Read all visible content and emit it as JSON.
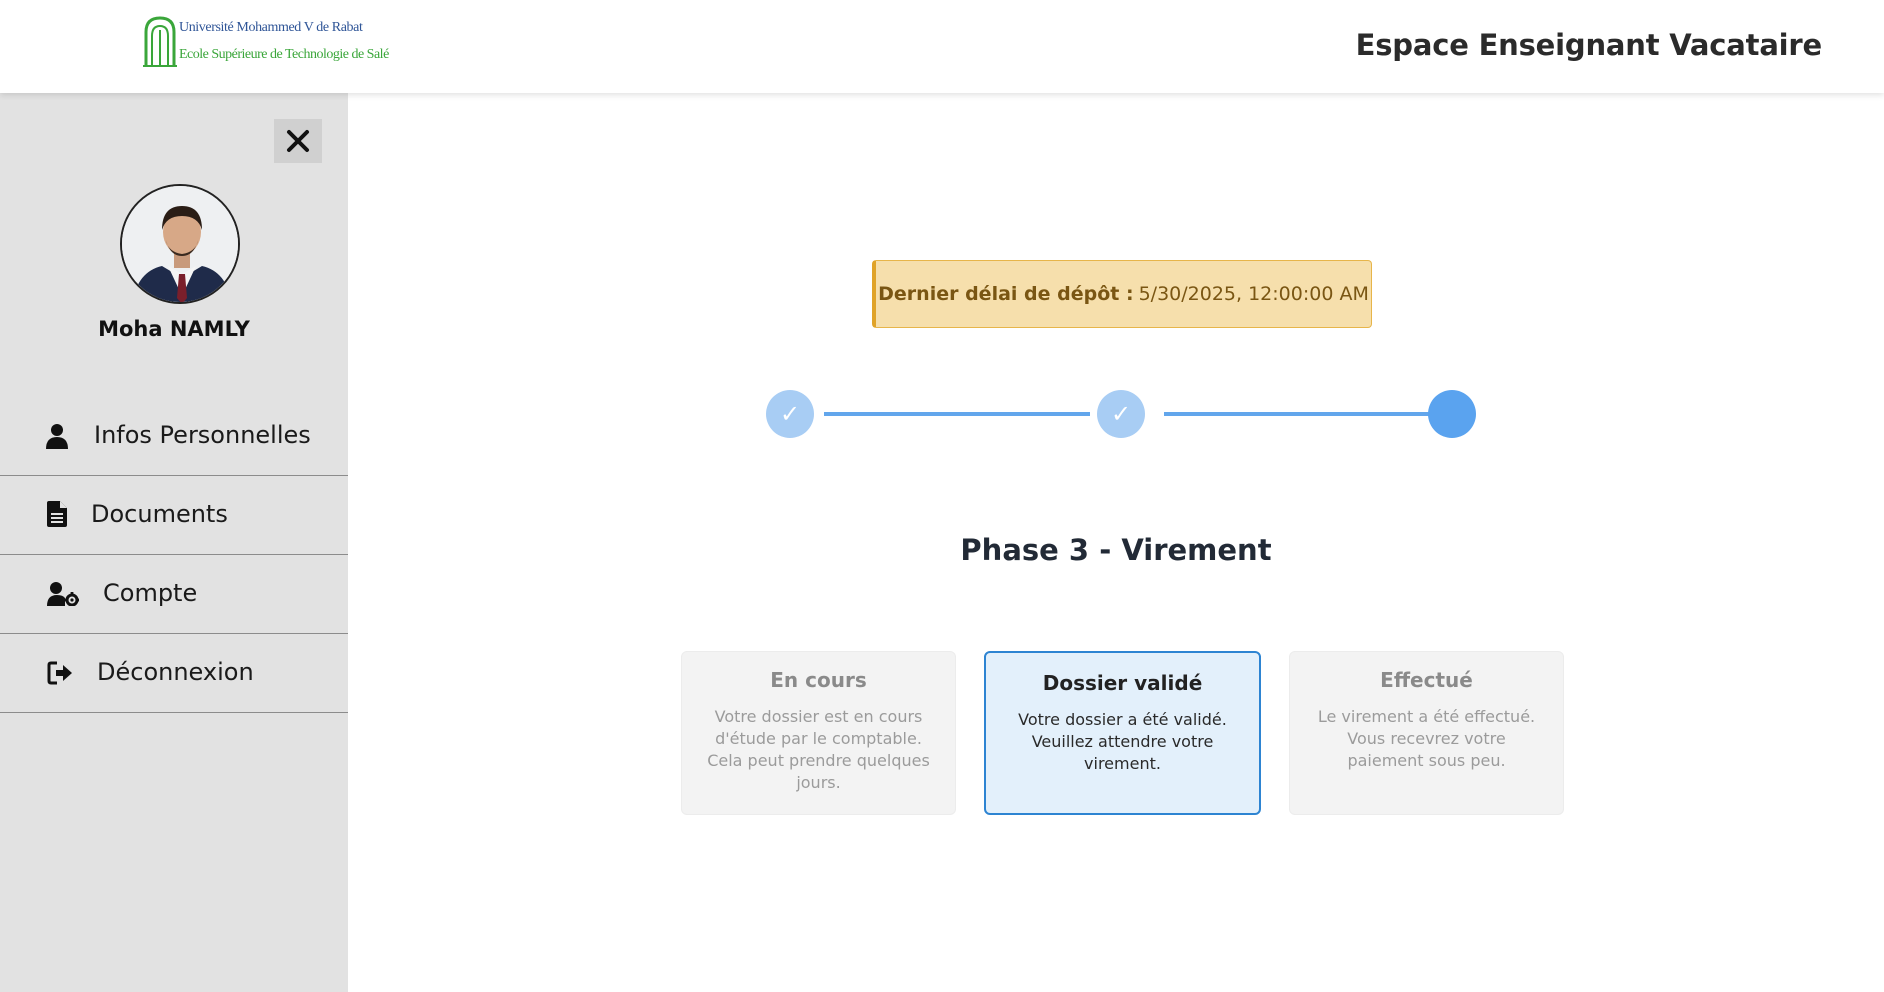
{
  "header": {
    "logo": {
      "line1": "Université Mohammed V de Rabat",
      "line2": "Ecole Supérieure de Technologie de Salé"
    },
    "app_title": "Espace Enseignant Vacataire"
  },
  "sidebar": {
    "close_icon": "close-icon",
    "user_name": "Moha NAMLY",
    "items": [
      {
        "label": "Infos Personnelles",
        "icon": "user-icon"
      },
      {
        "label": "Documents",
        "icon": "document-icon"
      },
      {
        "label": "Compte",
        "icon": "user-gear-icon"
      },
      {
        "label": "Déconnexion",
        "icon": "logout-icon"
      }
    ]
  },
  "main": {
    "deadline": {
      "label": "Dernier délai de dépôt :",
      "value": "5/30/2025, 12:00:00 AM"
    },
    "stepper": {
      "steps": [
        {
          "state": "done",
          "mark": "✓"
        },
        {
          "state": "done",
          "mark": "✓"
        },
        {
          "state": "active",
          "mark": ""
        }
      ]
    },
    "phase_title": "Phase 3 - Virement",
    "status_cards": [
      {
        "title": "En cours",
        "desc_lines": [
          "Votre dossier est en cours",
          "d'étude par le comptable.",
          "Cela peut prendre quelques",
          "jours."
        ],
        "state": "inactive"
      },
      {
        "title": "Dossier validé",
        "desc_lines": [
          "Votre dossier a été validé.",
          "Veuillez attendre votre",
          "virement."
        ],
        "state": "active"
      },
      {
        "title": "Effectué",
        "desc_lines": [
          "Le virement a été effectué.",
          "Vous recevrez votre",
          "paiement sous peu."
        ],
        "state": "inactive"
      }
    ]
  },
  "colors": {
    "accent": "#5aa3ef",
    "step_done": "#a8cdf4",
    "active_card_border": "#2d84d2",
    "deadline_bg": "#f6dfac",
    "sidebar_bg": "#e2e2e2"
  }
}
